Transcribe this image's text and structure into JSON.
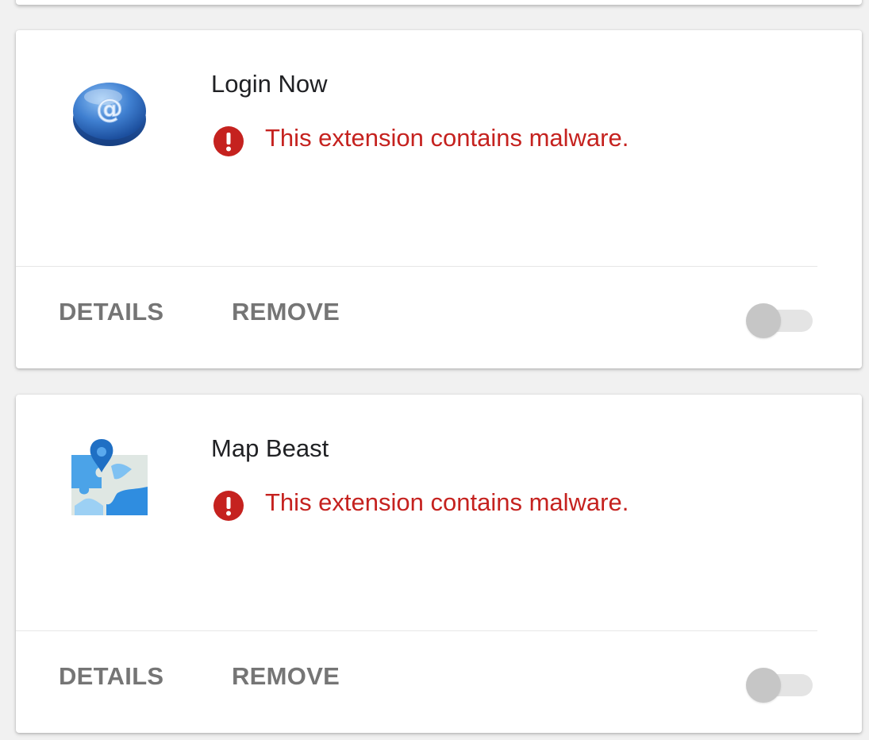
{
  "extensions": [
    {
      "name": "Login Now",
      "icon": "at-sign-email-icon",
      "warning": "This extension contains malware.",
      "details_label": "DETAILS",
      "remove_label": "REMOVE",
      "enabled": false
    },
    {
      "name": "Map Beast",
      "icon": "map-puzzle-icon",
      "warning": "This extension contains malware.",
      "details_label": "DETAILS",
      "remove_label": "REMOVE",
      "enabled": false
    }
  ],
  "colors": {
    "warning": "#c5221f",
    "button_text": "#757575",
    "toggle_off_knob": "#c6c6c6",
    "toggle_off_track": "#e4e4e4"
  }
}
